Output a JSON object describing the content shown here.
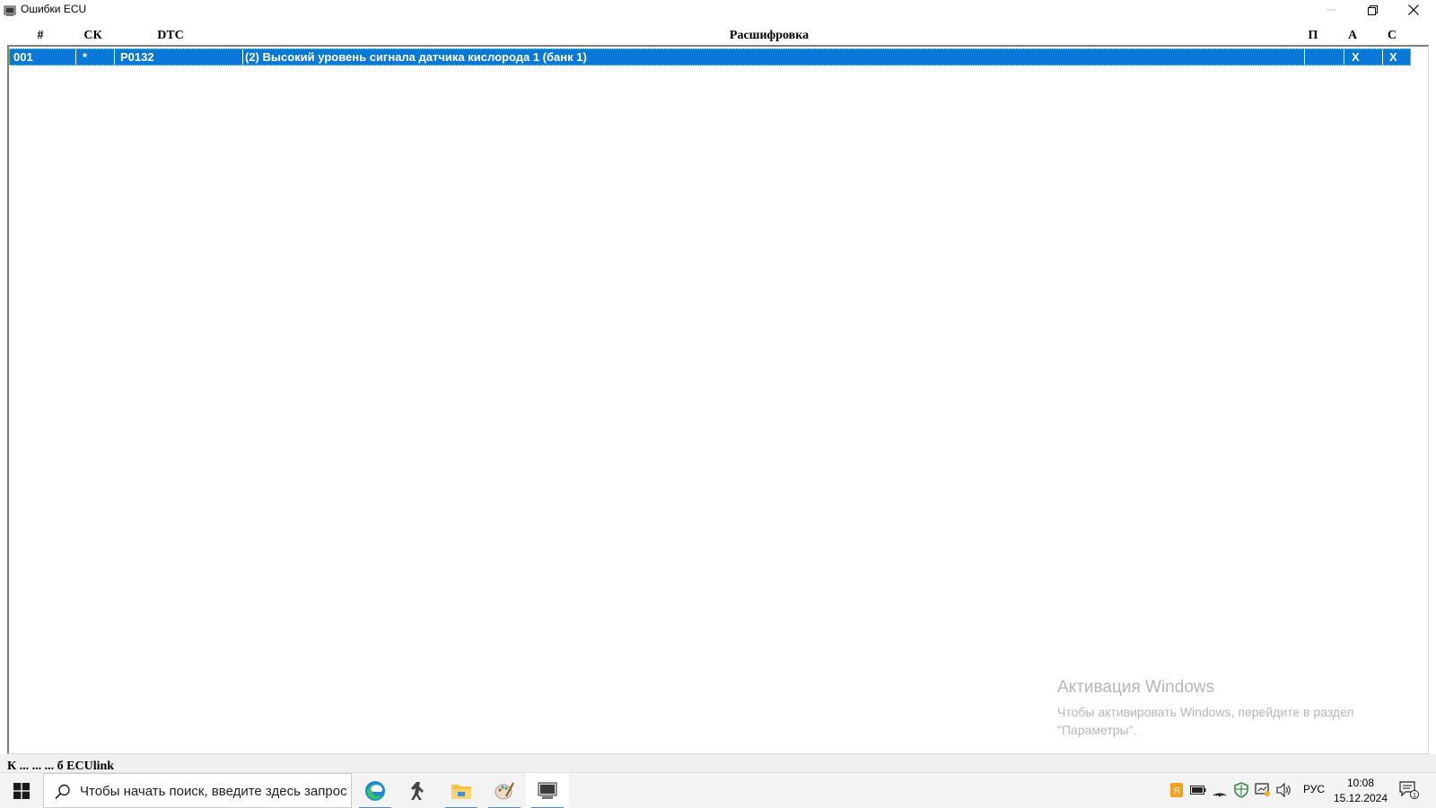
{
  "window": {
    "title": "Ошибки ECU",
    "icon": "app-window-icon"
  },
  "grid": {
    "columns": [
      {
        "key": "num",
        "label": "#"
      },
      {
        "key": "sk",
        "label": "СК"
      },
      {
        "key": "dtc",
        "label": "DTC"
      },
      {
        "key": "desc",
        "label": "Расшифровка"
      },
      {
        "key": "p",
        "label": "П"
      },
      {
        "key": "a",
        "label": "А"
      },
      {
        "key": "c",
        "label": "С"
      }
    ],
    "rows": [
      {
        "num": "001",
        "sk": "*",
        "dtc": "P0132",
        "desc": "(2) Высокий уровень сигнала датчика кислорода 1 (банк 1)",
        "p": "",
        "a": "X",
        "c": "X",
        "selected": true
      }
    ],
    "selection_color": "#0a78d7"
  },
  "watermark": {
    "title": "Активация Windows",
    "line1": "Чтобы активировать Windows, перейдите в раздел",
    "line2": "\"Параметры\"."
  },
  "status_strip": {
    "text": "К ... ... ... б ECUlink"
  },
  "taskbar": {
    "search_placeholder": "Чтобы начать поиск, введите здесь запрос",
    "apps": [
      {
        "name": "edge-icon",
        "running": true
      },
      {
        "name": "counter-strike-icon",
        "running": false
      },
      {
        "name": "file-explorer-icon",
        "running": true
      },
      {
        "name": "paint-icon",
        "running": true
      },
      {
        "name": "ecu-app-icon",
        "running": true,
        "active": true
      }
    ],
    "tray": {
      "language": "РУС",
      "time": "10:08",
      "date": "15.12.2024",
      "notification_count": "1"
    }
  }
}
